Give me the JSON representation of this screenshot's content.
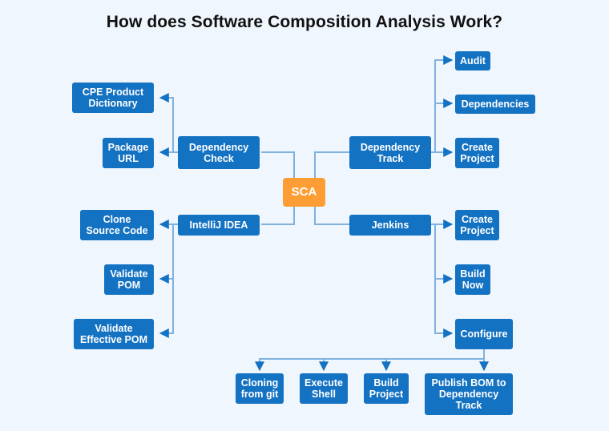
{
  "title": "How does Software Composition Analysis Work?",
  "colors": {
    "background": "#eff6fd",
    "node": "#1472c2",
    "root_node": "#fd9d34",
    "connector": "#7fb2de",
    "arrowhead": "#1472c2",
    "text_on_node": "#ffffff",
    "title": "#111111"
  },
  "root": {
    "id": "sca",
    "label": "SCA"
  },
  "branches": [
    {
      "id": "dependency-check",
      "label": "Dependency\nCheck",
      "side": "left",
      "children": [
        {
          "id": "cpe-product-dictionary",
          "label": "CPE Product\nDictionary"
        },
        {
          "id": "package-url",
          "label": "Package\nURL"
        }
      ]
    },
    {
      "id": "intellij-idea",
      "label": "IntelliJ IDEA",
      "side": "left",
      "children": [
        {
          "id": "clone-source-code",
          "label": "Clone\nSource Code"
        },
        {
          "id": "validate-pom",
          "label": "Validate\nPOM"
        },
        {
          "id": "validate-effective-pom",
          "label": "Validate\nEffective POM"
        }
      ]
    },
    {
      "id": "dependency-track",
      "label": "Dependency\nTrack",
      "side": "right",
      "children": [
        {
          "id": "audit",
          "label": "Audit"
        },
        {
          "id": "dependencies",
          "label": "Dependencies"
        },
        {
          "id": "dt-create-project",
          "label": "Create\nProject"
        }
      ]
    },
    {
      "id": "jenkins",
      "label": "Jenkins",
      "side": "right",
      "children": [
        {
          "id": "jenkins-create-project",
          "label": "Create\nProject"
        },
        {
          "id": "build-now",
          "label": "Build\nNow"
        },
        {
          "id": "configure",
          "label": "Configure",
          "children": [
            {
              "id": "cloning-from-git",
              "label": "Cloning\nfrom git"
            },
            {
              "id": "execute-shell",
              "label": "Execute\nShell"
            },
            {
              "id": "build-project",
              "label": "Build\nProject"
            },
            {
              "id": "publish-bom",
              "label": "Publish BOM to\nDependency\nTrack"
            }
          ]
        }
      ]
    }
  ]
}
